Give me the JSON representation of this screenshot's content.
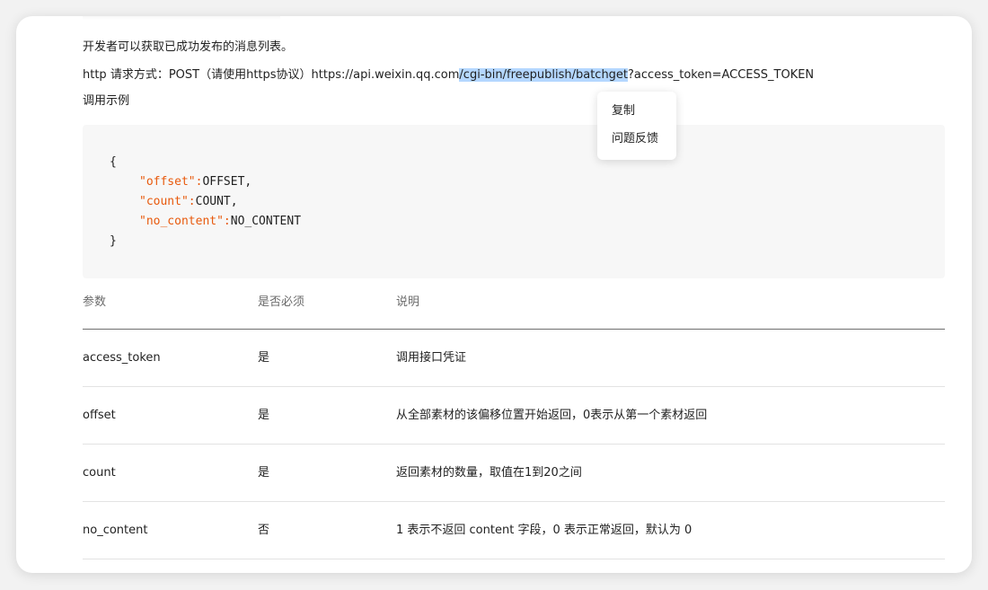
{
  "content": {
    "description": "开发者可以获取已成功发布的消息列表。",
    "http_prefix": "http 请求方式：POST（请使用https协议）https://api.weixin.qq.com",
    "http_highlight": "/cgi-bin/freepublish/batchget",
    "http_suffix": "?access_token=ACCESS_TOKEN",
    "example_label": "调用示例"
  },
  "code": {
    "open": "{",
    "lines": [
      {
        "key": "\"offset\":",
        "value": "OFFSET,"
      },
      {
        "key": "\"count\":",
        "value": "COUNT,"
      },
      {
        "key": "\"no_content\":",
        "value": "NO_CONTENT"
      }
    ],
    "close": "}"
  },
  "context_menu": {
    "copy": "复制",
    "feedback": "问题反馈"
  },
  "table": {
    "headers": [
      "参数",
      "是否必须",
      "说明"
    ],
    "rows": [
      [
        "access_token",
        "是",
        "调用接口凭证"
      ],
      [
        "offset",
        "是",
        "从全部素材的该偏移位置开始返回，0表示从第一个素材返回"
      ],
      [
        "count",
        "是",
        "返回素材的数量，取值在1到20之间"
      ],
      [
        "no_content",
        "否",
        "1 表示不返回 content 字段，0 表示正常返回，默认为 0"
      ]
    ]
  },
  "colors": {
    "highlight": "#b4d7ff",
    "code_key": "#e8590c"
  }
}
